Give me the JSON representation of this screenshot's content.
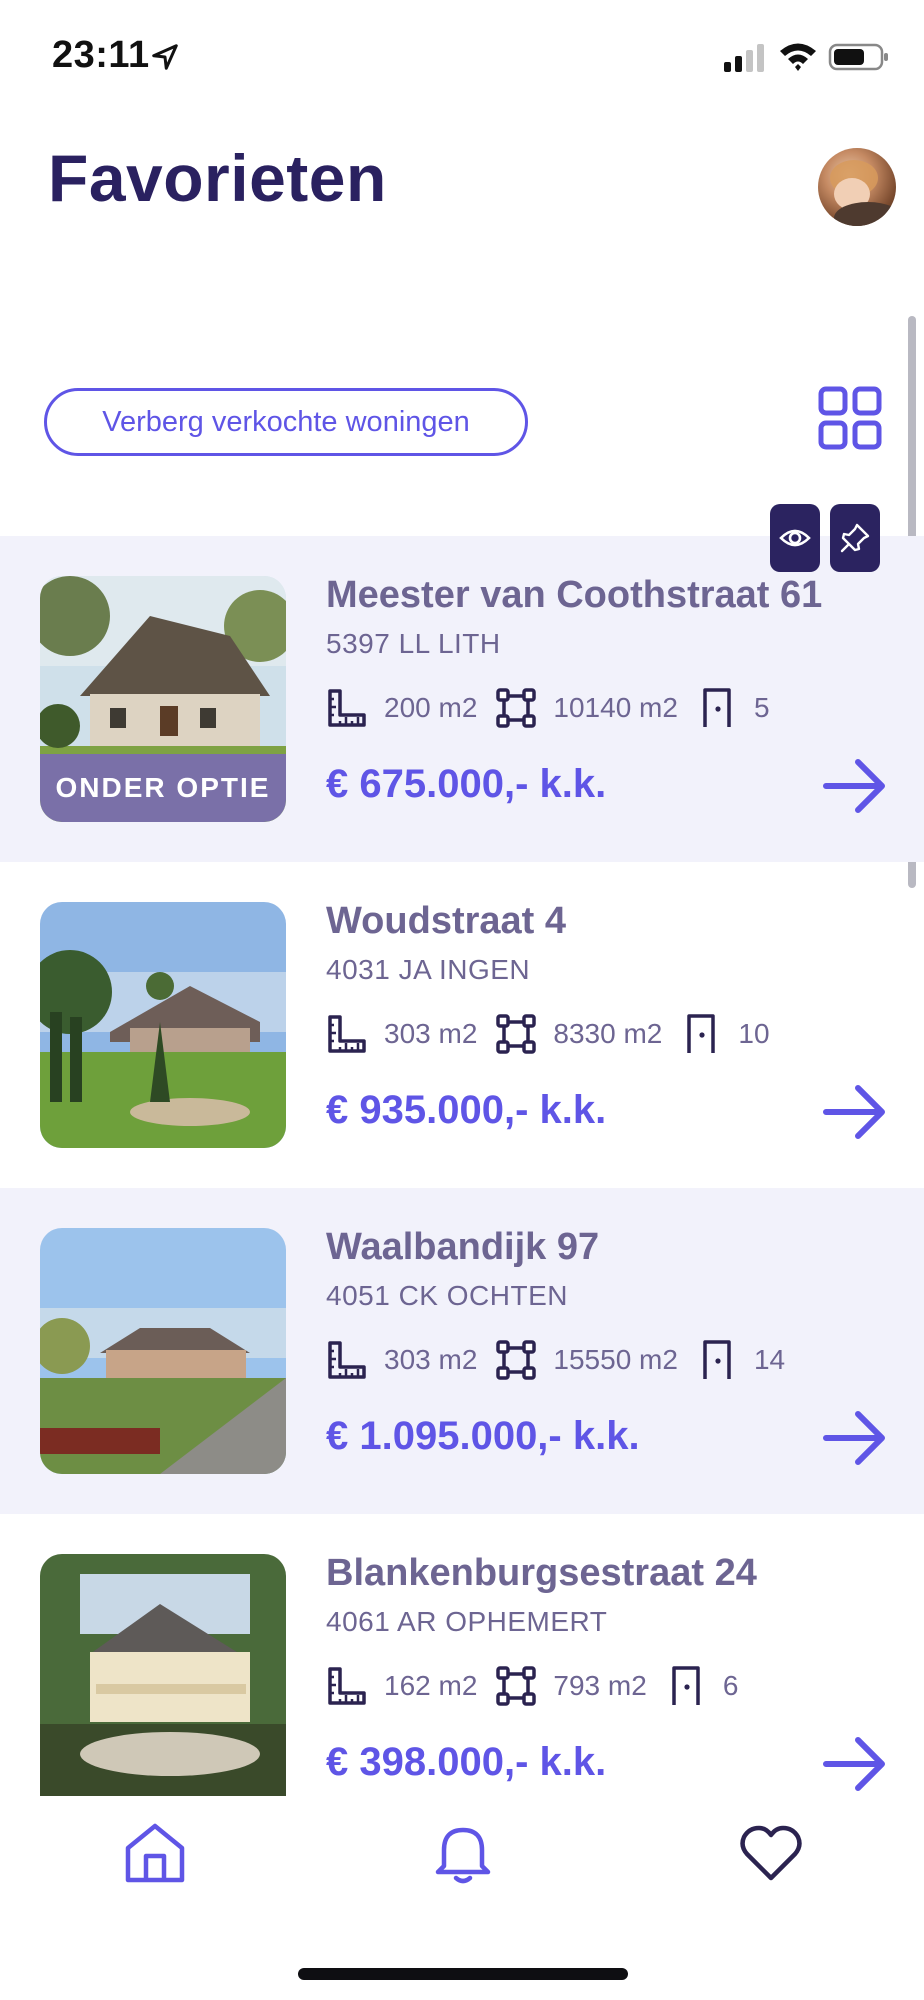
{
  "status_bar": {
    "time": "23:11"
  },
  "header": {
    "title": "Favorieten"
  },
  "filter": {
    "hide_sold_label": "Verberg verkochte woningen"
  },
  "colors": {
    "accent": "#5f55e6",
    "title": "#2a2160",
    "muted": "#6d6592",
    "badge": "#7a70a8",
    "dark_button": "#2b2360",
    "shaded_row": "#f2f2fb"
  },
  "listings": [
    {
      "street": "Meester van Coothstraat 61",
      "city": "5397 LL LITH",
      "living_area": "200 m2",
      "plot_area": "10140 m2",
      "rooms": "5",
      "price": "€ 675.000,- k.k.",
      "badge": "ONDER OPTIE"
    },
    {
      "street": "Woudstraat 4",
      "city": "4031 JA INGEN",
      "living_area": "303 m2",
      "plot_area": "8330 m2",
      "rooms": "10",
      "price": "€ 935.000,- k.k."
    },
    {
      "street": "Waalbandijk 97",
      "city": "4051 CK OCHTEN",
      "living_area": "303 m2",
      "plot_area": "15550 m2",
      "rooms": "14",
      "price": "€ 1.095.000,- k.k."
    },
    {
      "street": "Blankenburgsestraat 24",
      "city": "4061 AR OPHEMERT",
      "living_area": "162 m2",
      "plot_area": "793 m2",
      "rooms": "6",
      "price": "€ 398.000,- k.k."
    }
  ],
  "icons": {
    "living": "ruler-icon",
    "plot": "plot-area-icon",
    "rooms": "door-icon",
    "navigate": "arrow-right-icon"
  },
  "nav": {
    "items": [
      "home-icon",
      "bell-icon",
      "heart-icon"
    ]
  }
}
